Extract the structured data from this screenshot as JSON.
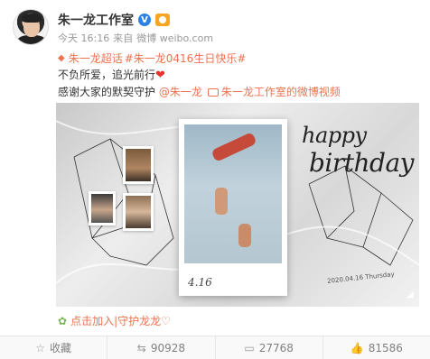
{
  "post": {
    "author": "朱一龙工作室",
    "verified_mark": "V",
    "time": "今天 16:16",
    "source_prefix": "来自",
    "source": "微博 weibo.com",
    "topic_1": "朱一龙超话",
    "topic_2": "#朱一龙0416生日快乐#",
    "line_2": "不负所爱，追光前行",
    "line_3_prefix": "感谢大家的默契守护",
    "mention": "@朱一龙",
    "video_link": "朱一龙工作室的微博视频"
  },
  "media": {
    "happy": "happy",
    "birthday": "birthday",
    "signature": "4.16",
    "datestamp": "2020.04.16  Thursday"
  },
  "join_text": "点击加入|守护龙龙♡",
  "actions": {
    "favorite": "收藏",
    "repost_count": "90928",
    "comment_count": "27768",
    "like_count": "81586"
  },
  "icons": [
    "diamond-icon",
    "heart-icon",
    "video-icon",
    "star-icon",
    "repost-icon",
    "comment-icon",
    "like-icon"
  ],
  "colors": {
    "link": "#eb7350",
    "verified": "#2a82e4",
    "heart": "#e8332d"
  }
}
